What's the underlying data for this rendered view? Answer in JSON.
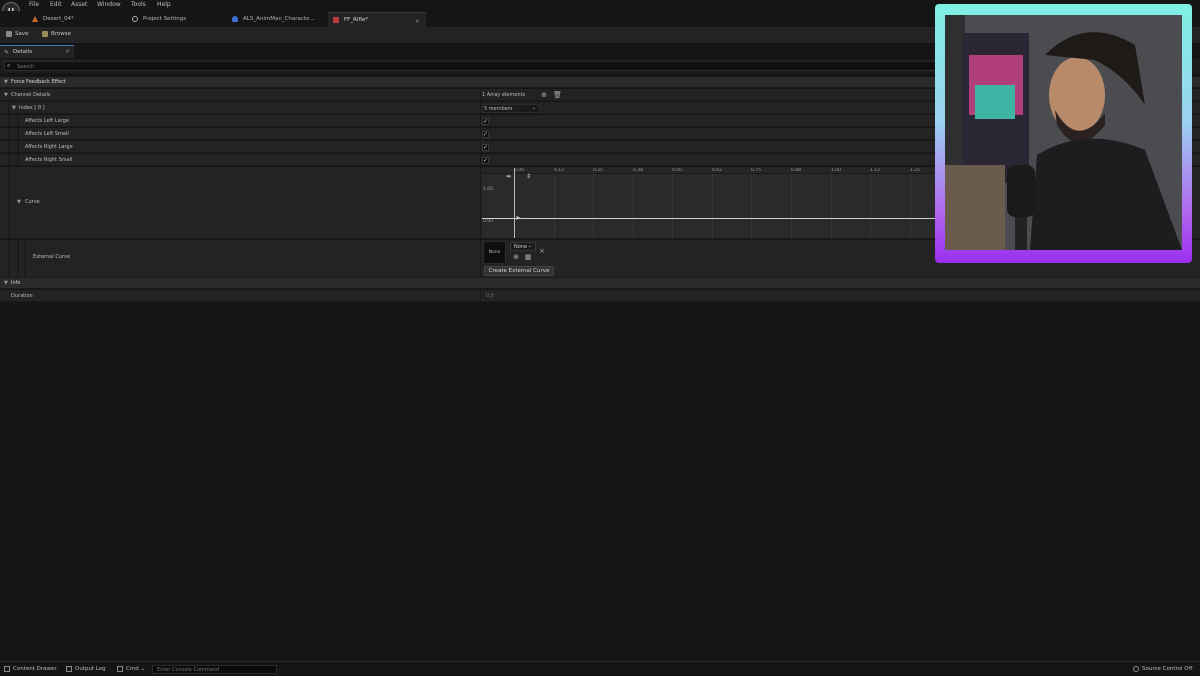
{
  "menu": [
    "File",
    "Edit",
    "Asset",
    "Window",
    "Tools",
    "Help"
  ],
  "tabs": [
    {
      "label": "Desert_04*",
      "icon": "level-icon"
    },
    {
      "label": "Project Settings",
      "icon": "settings-icon"
    },
    {
      "label": "ALS_AnimMan_Characte...",
      "icon": "character-icon"
    },
    {
      "label": "FF_Rifle*",
      "icon": "force-feedback-icon"
    }
  ],
  "toolbar": {
    "save_label": "Save",
    "browse_label": "Browse"
  },
  "details": {
    "tab_label": "Details",
    "search_placeholder": "Search"
  },
  "properties": {
    "force_feedback_effect": "Force Feedback Effect",
    "channel_details": "Channel Details",
    "channel_details_value": "1 Array elements",
    "index0": "Index [ 0 ]",
    "index0_value": "5 members",
    "affects_left_large": "Affects Left Large",
    "affects_left_small": "Affects Left Small",
    "affects_right_large": "Affects Right Large",
    "affects_right_small": "Affects Right Small",
    "curve": "Curve",
    "external_curve": "External Curve",
    "external_curve_thumb": "None",
    "external_curve_select": "None",
    "create_external_curve": "Create External Curve",
    "info": "Info",
    "duration": "Duration",
    "duration_value": "0.0"
  },
  "curve_editor": {
    "ruler_ticks": [
      "0.00",
      "0.12",
      "0.25",
      "0.38",
      "0.50",
      "0.62",
      "0.75",
      "0.88",
      "1.00",
      "1.12",
      "1.25"
    ],
    "y_labels": [
      "1.00",
      "0.00"
    ]
  },
  "statusbar": {
    "content_drawer": "Content Drawer",
    "output_log": "Output Log",
    "cmd": "Cmd",
    "console_placeholder": "Enter Console Command",
    "source_control": "Source Control Off"
  }
}
